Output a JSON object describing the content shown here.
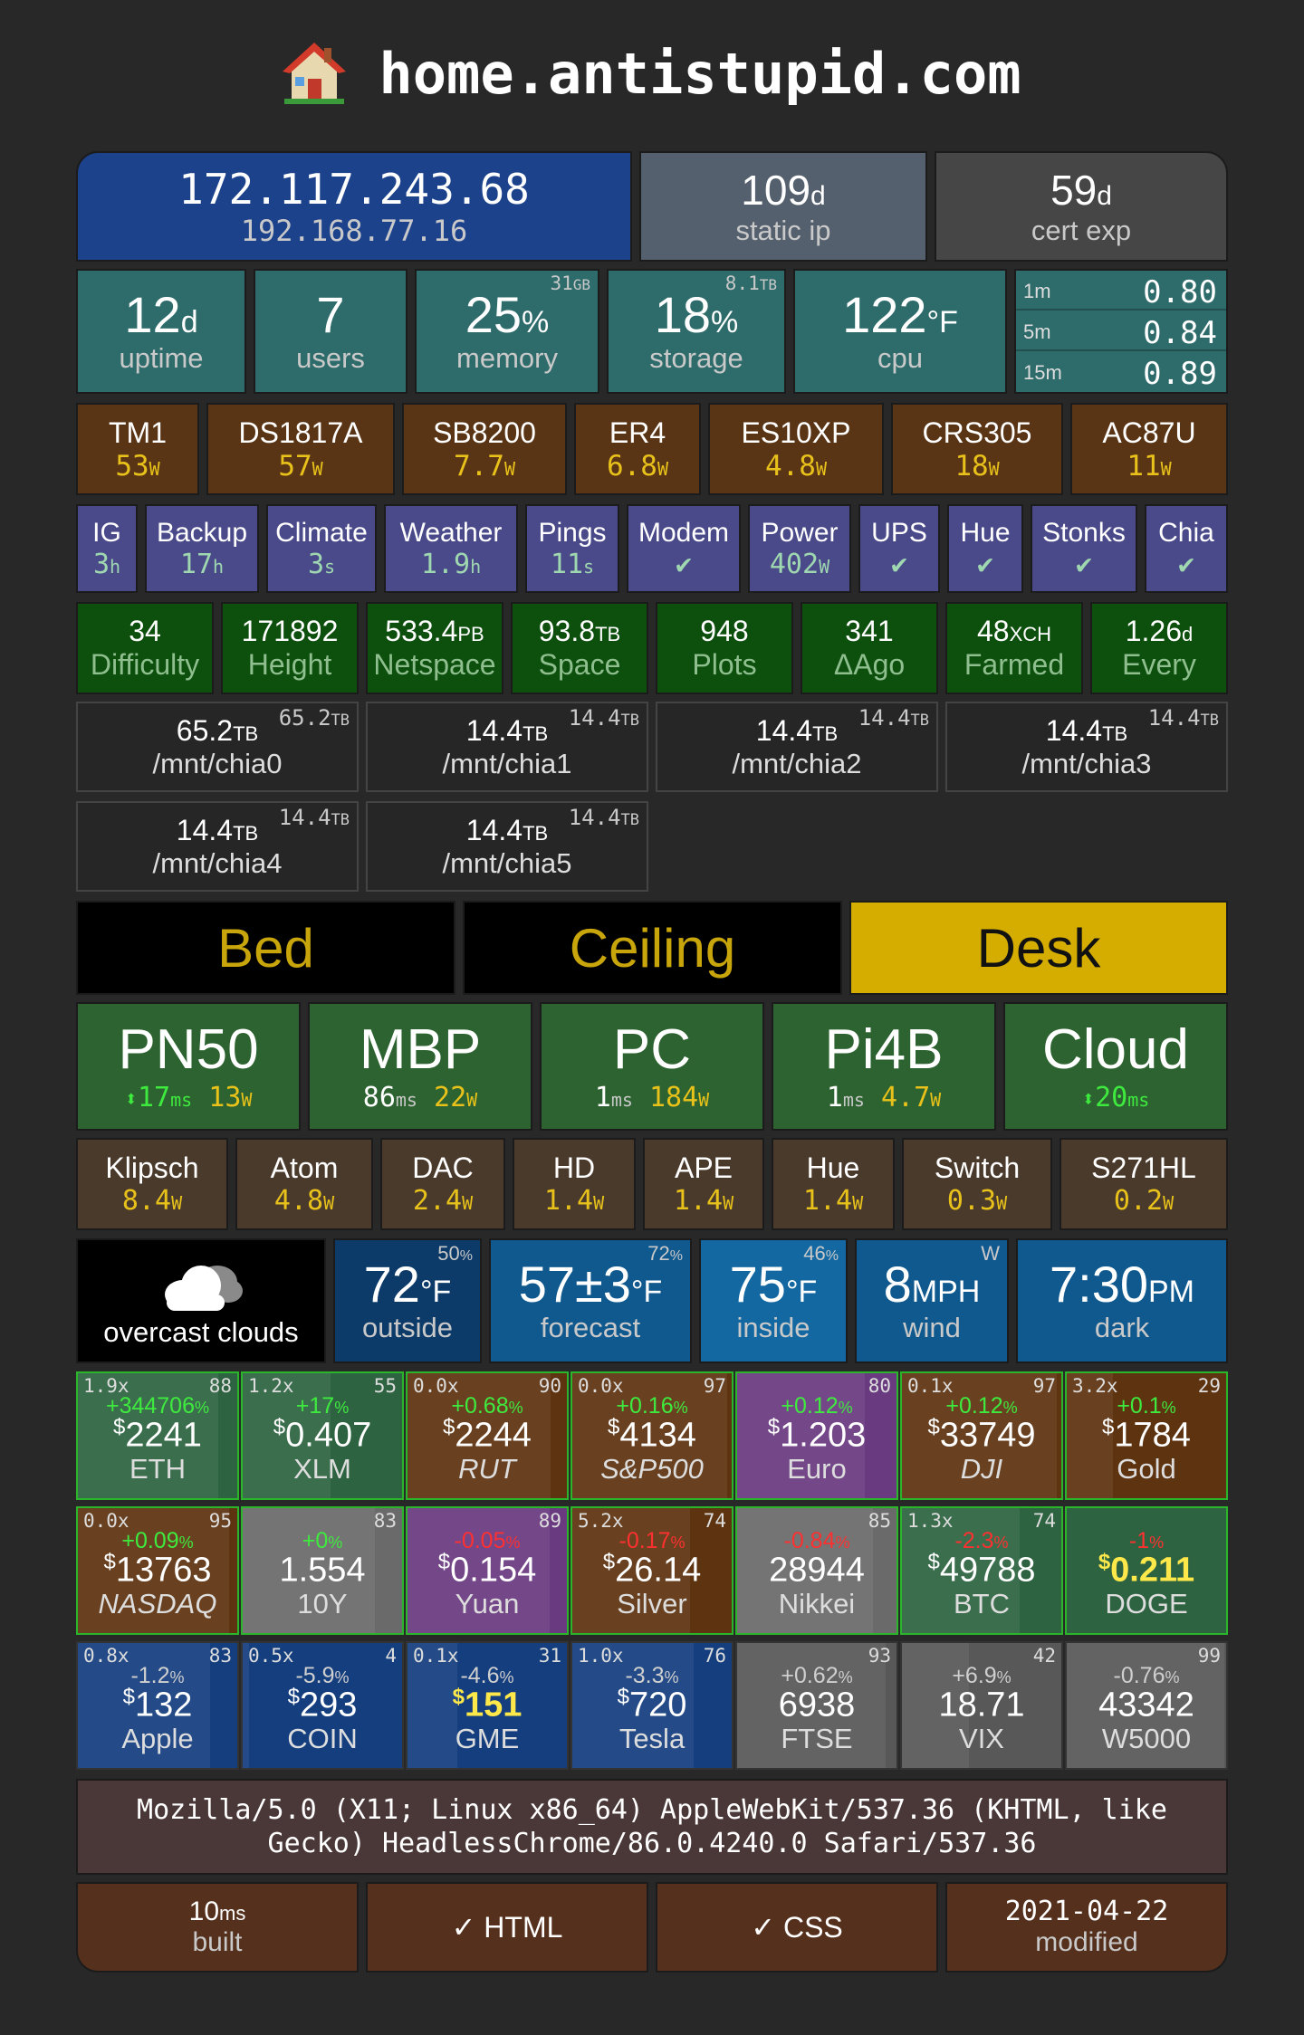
{
  "header": {
    "title": "home.antistupid.com",
    "icon": "house-icon"
  },
  "network": {
    "public_ip": "172.117.243.68",
    "local_ip": "192.168.77.16",
    "static_ip": {
      "value": "109",
      "unit": "d",
      "label": "static ip"
    },
    "cert": {
      "value": "59",
      "unit": "d",
      "label": "cert exp"
    }
  },
  "system": {
    "uptime": {
      "value": "12",
      "unit": "d",
      "label": "uptime"
    },
    "users": {
      "value": "7",
      "label": "users"
    },
    "memory": {
      "value": "25",
      "unit": "%",
      "corner": "31",
      "corner_unit": "GB",
      "label": "memory"
    },
    "storage": {
      "value": "18",
      "unit": "%",
      "corner": "8.1",
      "corner_unit": "TB",
      "label": "storage"
    },
    "cpu": {
      "value": "122",
      "unit": "°F",
      "label": "cpu"
    },
    "load": [
      {
        "label": "1m",
        "value": "0.80"
      },
      {
        "label": "5m",
        "value": "0.84"
      },
      {
        "label": "15m",
        "value": "0.89"
      }
    ]
  },
  "power": [
    {
      "name": "TM1",
      "value": "53",
      "unit": "W"
    },
    {
      "name": "DS1817A",
      "value": "57",
      "unit": "W"
    },
    {
      "name": "SB8200",
      "value": "7.7",
      "unit": "W"
    },
    {
      "name": "ER4",
      "value": "6.8",
      "unit": "W"
    },
    {
      "name": "ES10XP",
      "value": "4.8",
      "unit": "W"
    },
    {
      "name": "CRS305",
      "value": "18",
      "unit": "W"
    },
    {
      "name": "AC87U",
      "value": "11",
      "unit": "W"
    }
  ],
  "jobs": [
    {
      "name": "IG",
      "value": "3",
      "unit": "h"
    },
    {
      "name": "Backup",
      "value": "17",
      "unit": "h"
    },
    {
      "name": "Climate",
      "value": "3",
      "unit": "s"
    },
    {
      "name": "Weather",
      "value": "1.9",
      "unit": "h"
    },
    {
      "name": "Pings",
      "value": "11",
      "unit": "s"
    },
    {
      "name": "Modem",
      "value": "✔",
      "unit": ""
    },
    {
      "name": "Power",
      "value": "402",
      "unit": "W"
    },
    {
      "name": "UPS",
      "value": "✔",
      "unit": ""
    },
    {
      "name": "Hue",
      "value": "✔",
      "unit": ""
    },
    {
      "name": "Stonks",
      "value": "✔",
      "unit": ""
    },
    {
      "name": "Chia",
      "value": "✔",
      "unit": ""
    }
  ],
  "chia": [
    {
      "value": "34",
      "unit": "",
      "label": "Difficulty"
    },
    {
      "value": "171892",
      "unit": "",
      "label": "Height"
    },
    {
      "value": "533.4",
      "unit": "PB",
      "label": "Netspace"
    },
    {
      "value": "93.8",
      "unit": "TB",
      "label": "Space"
    },
    {
      "value": "948",
      "unit": "",
      "label": "Plots"
    },
    {
      "value": "341",
      "unit": "",
      "label": "ΔAgo"
    },
    {
      "value": "48",
      "unit": "XCH",
      "label": "Farmed"
    },
    {
      "value": "1.26",
      "unit": "d",
      "label": "Every"
    }
  ],
  "mounts": [
    {
      "value": "65.2",
      "unit": "TB",
      "corner": "65.2",
      "corner_unit": "TB",
      "path": "/mnt/chia0"
    },
    {
      "value": "14.4",
      "unit": "TB",
      "corner": "14.4",
      "corner_unit": "TB",
      "path": "/mnt/chia1"
    },
    {
      "value": "14.4",
      "unit": "TB",
      "corner": "14.4",
      "corner_unit": "TB",
      "path": "/mnt/chia2"
    },
    {
      "value": "14.4",
      "unit": "TB",
      "corner": "14.4",
      "corner_unit": "TB",
      "path": "/mnt/chia3"
    },
    {
      "value": "14.4",
      "unit": "TB",
      "corner": "14.4",
      "corner_unit": "TB",
      "path": "/mnt/chia4"
    },
    {
      "value": "14.4",
      "unit": "TB",
      "corner": "14.4",
      "corner_unit": "TB",
      "path": "/mnt/chia5"
    }
  ],
  "lights": [
    {
      "name": "Bed",
      "on": false
    },
    {
      "name": "Ceiling",
      "on": false
    },
    {
      "name": "Desk",
      "on": true
    }
  ],
  "hosts": [
    {
      "name": "PN50",
      "ping_prefix": "⬍",
      "ping": "17",
      "ping_unit": "ms",
      "power": "13",
      "power_unit": "W"
    },
    {
      "name": "MBP",
      "ping_prefix": "",
      "ping": "86",
      "ping_unit": "ms",
      "power": "22",
      "power_unit": "W"
    },
    {
      "name": "PC",
      "ping_prefix": "",
      "ping": "1",
      "ping_unit": "ms",
      "power": "184",
      "power_unit": "W"
    },
    {
      "name": "Pi4B",
      "ping_prefix": "",
      "ping": "1",
      "ping_unit": "ms",
      "power": "4.7",
      "power_unit": "W"
    },
    {
      "name": "Cloud",
      "ping_prefix": "⬍",
      "ping": "20",
      "ping_unit": "ms",
      "power": "",
      "power_unit": ""
    }
  ],
  "devices": [
    {
      "name": "Klipsch",
      "value": "8.4",
      "unit": "W"
    },
    {
      "name": "Atom",
      "value": "4.8",
      "unit": "W"
    },
    {
      "name": "DAC",
      "value": "2.4",
      "unit": "W"
    },
    {
      "name": "HD",
      "value": "1.4",
      "unit": "W"
    },
    {
      "name": "APE",
      "value": "1.4",
      "unit": "W"
    },
    {
      "name": "Hue",
      "value": "1.4",
      "unit": "W"
    },
    {
      "name": "Switch",
      "value": "0.3",
      "unit": "W"
    },
    {
      "name": "S271HL",
      "value": "0.2",
      "unit": "W"
    }
  ],
  "weather": {
    "condition": "overcast clouds",
    "icon": "cloud-icon",
    "outside": {
      "value": "72",
      "unit": "°F",
      "corner": "50",
      "corner_unit": "%",
      "label": "outside"
    },
    "forecast": {
      "value": "57±3",
      "unit": "°F",
      "corner": "72",
      "corner_unit": "%",
      "label": "forecast"
    },
    "inside": {
      "value": "75",
      "unit": "°F",
      "corner": "46",
      "corner_unit": "%",
      "label": "inside"
    },
    "wind": {
      "value": "8",
      "unit": "MPH",
      "corner": "W",
      "label": "wind"
    },
    "dark": {
      "value": "7:30",
      "unit": "PM",
      "label": "dark"
    }
  },
  "markets": [
    {
      "mult": "1.9x",
      "corner": "88",
      "change": "+344706",
      "sign": "up",
      "prefix": "$",
      "value": "2241",
      "name": "ETH",
      "italic": false,
      "bg": "#2d6340",
      "fill": 0.88,
      "hl": false
    },
    {
      "mult": "1.2x",
      "corner": "55",
      "change": "+17",
      "sign": "up",
      "prefix": "$",
      "value": "0.407",
      "name": "XLM",
      "italic": false,
      "bg": "#2d6340",
      "fill": 0.55,
      "hl": false
    },
    {
      "mult": "0.0x",
      "corner": "90",
      "change": "+0.68",
      "sign": "up",
      "prefix": "$",
      "value": "2244",
      "name": "RUT",
      "italic": true,
      "bg": "#5e3310",
      "fill": 0.9,
      "hl": false
    },
    {
      "mult": "0.0x",
      "corner": "97",
      "change": "+0.16",
      "sign": "up",
      "prefix": "$",
      "value": "4134",
      "name": "S&P500",
      "italic": true,
      "bg": "#5e3310",
      "fill": 0.97,
      "hl": false
    },
    {
      "mult": "",
      "corner": "80",
      "change": "+0.12",
      "sign": "up",
      "prefix": "$",
      "value": "1.203",
      "name": "Euro",
      "italic": false,
      "bg": "#6a3a80",
      "fill": 0.8,
      "hl": false
    },
    {
      "mult": "0.1x",
      "corner": "97",
      "change": "+0.12",
      "sign": "up",
      "prefix": "$",
      "value": "33749",
      "name": "DJI",
      "italic": true,
      "bg": "#5e3310",
      "fill": 0.97,
      "hl": false
    },
    {
      "mult": "3.2x",
      "corner": "29",
      "change": "+0.1",
      "sign": "up",
      "prefix": "$",
      "value": "1784",
      "name": "Gold",
      "italic": false,
      "bg": "#5e3310",
      "fill": 0.29,
      "hl": false
    },
    {
      "mult": "0.0x",
      "corner": "95",
      "change": "+0.09",
      "sign": "up",
      "prefix": "$",
      "value": "13763",
      "name": "NASDAQ",
      "italic": true,
      "bg": "#5e3310",
      "fill": 0.95,
      "hl": false
    },
    {
      "mult": "",
      "corner": "83",
      "change": "+0",
      "sign": "up",
      "prefix": "",
      "value": "1.554",
      "name": "10Y",
      "italic": false,
      "bg": "#6a6a6a",
      "fill": 0.83,
      "hl": false
    },
    {
      "mult": "",
      "corner": "89",
      "change": "-0.05",
      "sign": "down",
      "prefix": "$",
      "value": "0.154",
      "name": "Yuan",
      "italic": false,
      "bg": "#6a3a80",
      "fill": 0.89,
      "hl": false
    },
    {
      "mult": "5.2x",
      "corner": "74",
      "change": "-0.17",
      "sign": "down",
      "prefix": "$",
      "value": "26.14",
      "name": "Silver",
      "italic": false,
      "bg": "#5e3310",
      "fill": 0.74,
      "hl": false
    },
    {
      "mult": "",
      "corner": "85",
      "change": "-0.84",
      "sign": "down",
      "prefix": "",
      "value": "28944",
      "name": "Nikkei",
      "italic": false,
      "bg": "#6a6a6a",
      "fill": 0.85,
      "hl": false
    },
    {
      "mult": "1.3x",
      "corner": "74",
      "change": "-2.3",
      "sign": "down",
      "prefix": "$",
      "value": "49788",
      "name": "BTC",
      "italic": false,
      "bg": "#2d6340",
      "fill": 0.74,
      "hl": false
    },
    {
      "mult": "",
      "corner": "",
      "change": "-1",
      "sign": "down",
      "prefix": "$",
      "value": "0.211",
      "name": "DOGE",
      "italic": false,
      "bg": "#2d6340",
      "fill": 0.0,
      "hl": true
    },
    {
      "mult": "0.8x",
      "corner": "83",
      "change": "-1.2",
      "sign": "neutral",
      "prefix": "$",
      "value": "132",
      "name": "Apple",
      "italic": false,
      "bg": "#143e7e",
      "fill": 0.83,
      "hl": false
    },
    {
      "mult": "0.5x",
      "corner": "4",
      "change": "-5.9",
      "sign": "neutral",
      "prefix": "$",
      "value": "293",
      "name": "COIN",
      "italic": false,
      "bg": "#143e7e",
      "fill": 0.04,
      "hl": false
    },
    {
      "mult": "0.1x",
      "corner": "31",
      "change": "-4.6",
      "sign": "neutral",
      "prefix": "$",
      "value": "151",
      "name": "GME",
      "italic": false,
      "bg": "#143e7e",
      "fill": 0.31,
      "hl": true
    },
    {
      "mult": "1.0x",
      "corner": "76",
      "change": "-3.3",
      "sign": "neutral",
      "prefix": "$",
      "value": "720",
      "name": "Tesla",
      "italic": false,
      "bg": "#143e7e",
      "fill": 0.76,
      "hl": false
    },
    {
      "mult": "",
      "corner": "93",
      "change": "+0.62",
      "sign": "neutral",
      "prefix": "",
      "value": "6938",
      "name": "FTSE",
      "italic": false,
      "bg": "#585858",
      "fill": 0.93,
      "hl": false
    },
    {
      "mult": "",
      "corner": "42",
      "change": "+6.9",
      "sign": "neutral",
      "prefix": "",
      "value": "18.71",
      "name": "VIX",
      "italic": false,
      "bg": "#585858",
      "fill": 0.42,
      "hl": false
    },
    {
      "mult": "",
      "corner": "99",
      "change": "-0.76",
      "sign": "neutral",
      "prefix": "",
      "value": "43342",
      "name": "W5000",
      "italic": false,
      "bg": "#585858",
      "fill": 0.99,
      "hl": false
    }
  ],
  "user_agent": "Mozilla/5.0 (X11; Linux x86_64) AppleWebKit/537.36 (KHTML, like Gecko) HeadlessChrome/86.0.4240.0 Safari/537.36",
  "footer": {
    "built": {
      "value": "10",
      "unit": "ms",
      "label": "built"
    },
    "html": "✓ HTML",
    "css": "✓ CSS",
    "modified": {
      "value": "2021-04-22",
      "label": "modified"
    }
  },
  "colors": {
    "yellow": "#e8c21a",
    "green": "#3fea3f",
    "red": "#ff3030",
    "background": "#282828"
  }
}
